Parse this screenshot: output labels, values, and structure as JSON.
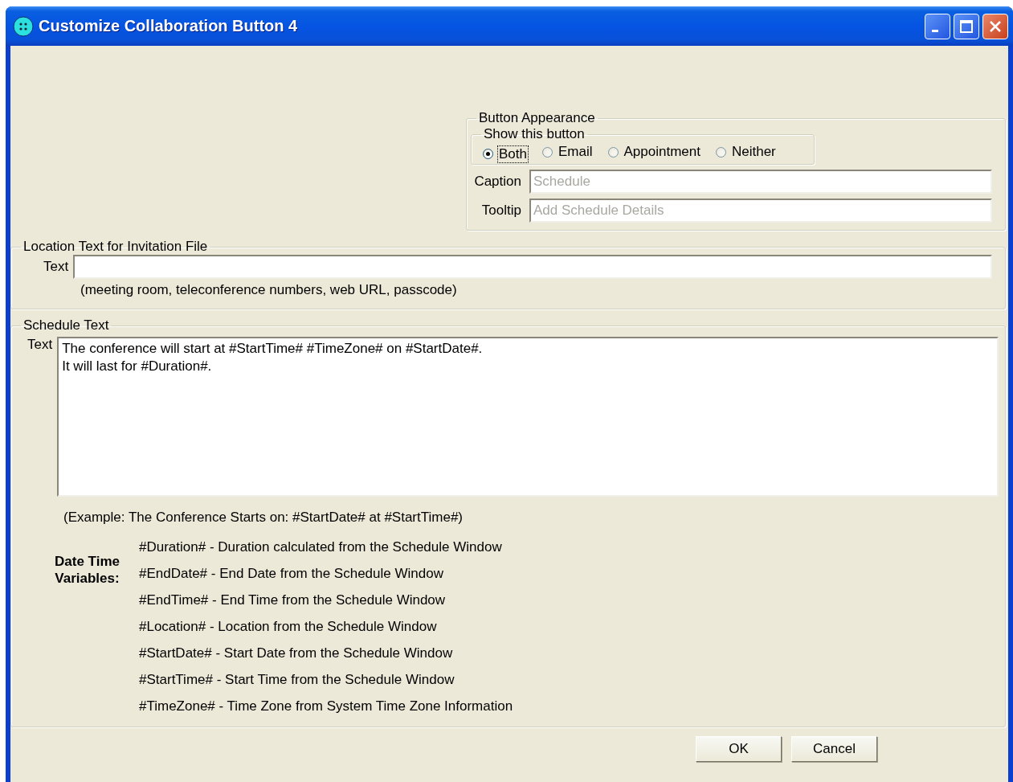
{
  "window": {
    "title": "Customize Collaboration Button 4"
  },
  "button_appearance": {
    "title": "Button Appearance",
    "show_group": {
      "title": "Show this button",
      "options": [
        {
          "label": "Both",
          "selected": true
        },
        {
          "label": "Email",
          "selected": false
        },
        {
          "label": "Appointment",
          "selected": false
        },
        {
          "label": "Neither",
          "selected": false
        }
      ]
    },
    "caption": {
      "label": "Caption",
      "placeholder": "Schedule"
    },
    "tooltip": {
      "label": "Tooltip",
      "placeholder": "Add Schedule Details"
    }
  },
  "location": {
    "title": "Location Text for Invitation File",
    "field_label": "Text",
    "hint": "(meeting room, teleconference numbers, web URL, passcode)"
  },
  "schedule": {
    "title": "Schedule Text",
    "field_label": "Text",
    "value": "The conference will start at #StartTime# #TimeZone# on #StartDate#.\nIt will last for #Duration#.",
    "example": "(Example: The Conference Starts on: #StartDate# at #StartTime#)",
    "variables_label": "Date Time\nVariables:",
    "variables": [
      "#Duration# - Duration calculated from the Schedule Window",
      "#EndDate# - End Date from the Schedule Window",
      "#EndTime# - End Time from the Schedule Window",
      "#Location# - Location from the Schedule Window",
      "#StartDate# - Start Date from the Schedule Window",
      "#StartTime# - Start Time from the Schedule Window",
      "#TimeZone# - Time Zone from System Time Zone Information"
    ]
  },
  "buttons": [
    "OK",
    "Cancel"
  ]
}
